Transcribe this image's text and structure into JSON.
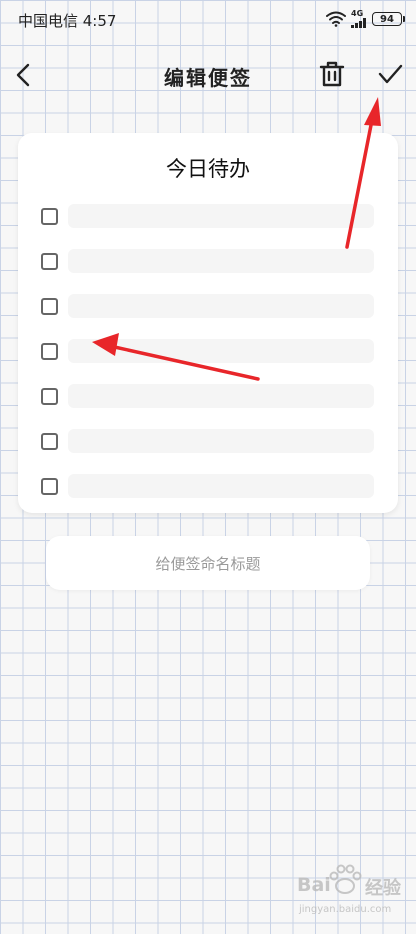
{
  "status_bar": {
    "carrier_time": "中国电信 4:57",
    "network": "4G",
    "battery": "94"
  },
  "header": {
    "title": "编辑便签",
    "back_icon": "chevron-left-icon",
    "delete_icon": "trash-icon",
    "confirm_icon": "check-icon"
  },
  "note": {
    "title": "今日待办",
    "items": [
      {
        "checked": false,
        "text": ""
      },
      {
        "checked": false,
        "text": ""
      },
      {
        "checked": false,
        "text": ""
      },
      {
        "checked": false,
        "text": ""
      },
      {
        "checked": false,
        "text": ""
      },
      {
        "checked": false,
        "text": ""
      },
      {
        "checked": false,
        "text": ""
      }
    ]
  },
  "name_field": {
    "placeholder": "给便签命名标题"
  },
  "watermark": {
    "brand": "Bai",
    "suffix": "经验",
    "url": "jingyan.baidu.com"
  },
  "colors": {
    "accent_arrow": "#e8262a",
    "grid_line": "#c9d3e6",
    "background": "#f7f7f7"
  }
}
